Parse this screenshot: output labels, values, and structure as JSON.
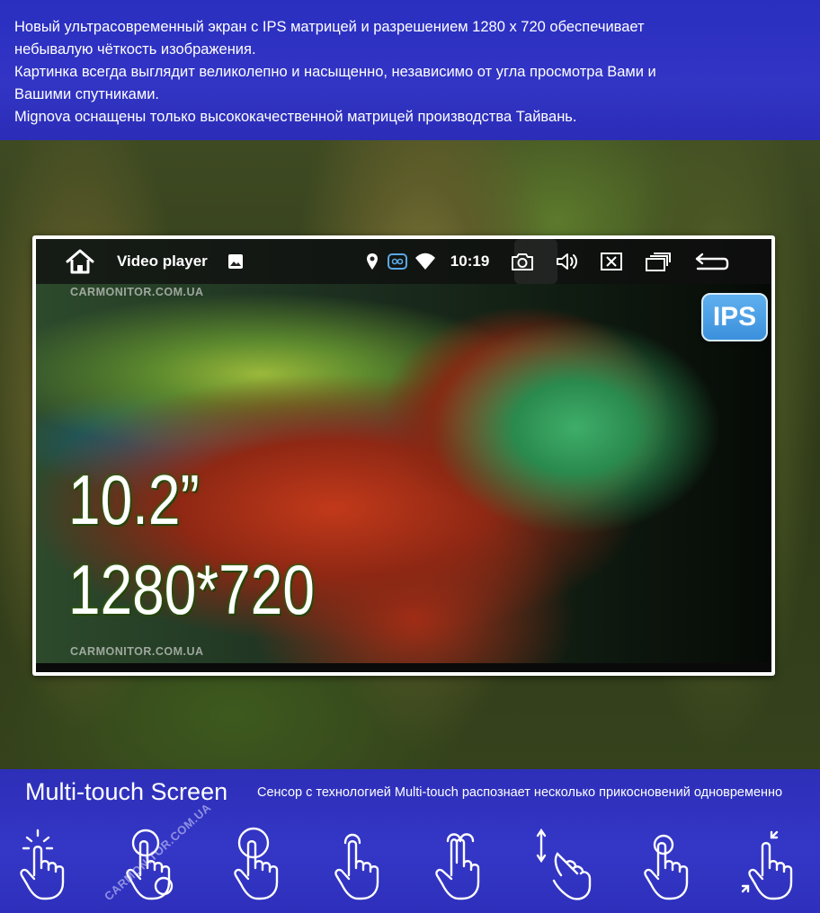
{
  "description": {
    "lines": [
      "Новый ультрасовременный экран с IPS матрицей и разрешением 1280 х 720 обеспечивает",
      "небывалую чёткость изображения.",
      "Картинка всегда выглядит великолепно и насыщенно, независимо от угла просмотра Вами и",
      "Вашими спутниками.",
      "Mignova оснащены только высококачественной матрицей производства Тайвань."
    ]
  },
  "screen": {
    "status_bar": {
      "app_title": "Video player",
      "time": "10:19",
      "icons": [
        "home-icon",
        "image-icon",
        "location-icon",
        "bluetooth-icon",
        "wifi-icon",
        "camera-icon",
        "volume-icon",
        "close-box-icon",
        "recent-apps-icon",
        "back-icon"
      ]
    },
    "watermark": "CARMONITOR.COM.UA",
    "badge": "IPS",
    "size": "10.2”",
    "resolution": "1280*720"
  },
  "multitouch": {
    "heading": "Multi-touch Screen",
    "caption": "Сенсор с технологией Multi-touch  распознает несколько прикосновений одновременно",
    "watermark": "CARMONITOR.COM.UA",
    "gestures": [
      "tap-gesture-icon",
      "double-tap-gesture-icon",
      "press-gesture-icon",
      "hold-gesture-icon",
      "two-finger-gesture-icon",
      "drag-gesture-icon",
      "point-gesture-icon",
      "pinch-gesture-icon"
    ]
  },
  "colors": {
    "banner_blue": "#3234c4",
    "ips_blue": "#3b90dc",
    "text_white": "#ffffff"
  }
}
